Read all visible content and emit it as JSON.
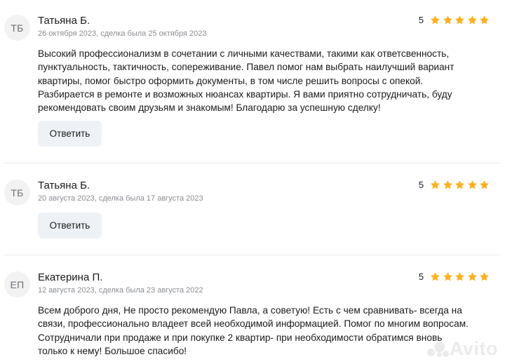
{
  "reviews": [
    {
      "initials": "ТБ",
      "name": "Татьяна Б.",
      "meta": "26 октября 2023, сделка была 25 октября 2023",
      "rating": "5",
      "stars": 5,
      "text_lines": [
        "Высокий профессионализм в сочетании с личными качествами, такими как ответсвенность,",
        "пунктуальность, тактичность, сопереживание. Павел помог нам выбрать наилучший вариант",
        "квартиры, помог быстро оформить документы, в том числе решить вопросы с опекой.",
        "Разбирается в ремонте и возможных нюансах квартиры. Я вами приятно сотрудничать, буду",
        "рекомендовать своим друзьям и знакомым! Благодарю за успешную сделку!"
      ],
      "reply_label": "Ответить"
    },
    {
      "initials": "ТБ",
      "name": "Татьяна Б.",
      "meta": "20 августа 2023, сделка была 17 августа 2023",
      "rating": "5",
      "stars": 5,
      "text_lines": [],
      "reply_label": "Ответить"
    },
    {
      "initials": "ЕП",
      "name": "Екатерина П.",
      "meta": "12 августа 2023, сделка была 23 августа 2022",
      "rating": "5",
      "stars": 5,
      "text_lines": [
        "Всем доброго дня, Не просто рекомендую Павла, а советую! Есть с чем сравнивать- всегда на",
        "связи, профессионально владеет всей необходимой информацией. Помог по многим вопросам.",
        "Сотрудничали при продаже и при покупке 2 квартир- при необходимости обратимся вновь",
        "только к нему! Большое спасибо!"
      ]
    }
  ],
  "watermark": {
    "text": "Avito",
    "color": "#b9b9b9"
  },
  "colors": {
    "star": "#ffb021",
    "button_bg": "#eef1f5",
    "meta": "#8a8d92",
    "avatar_bg": "#f2f2f3"
  },
  "icons": {
    "star": "star-icon"
  }
}
